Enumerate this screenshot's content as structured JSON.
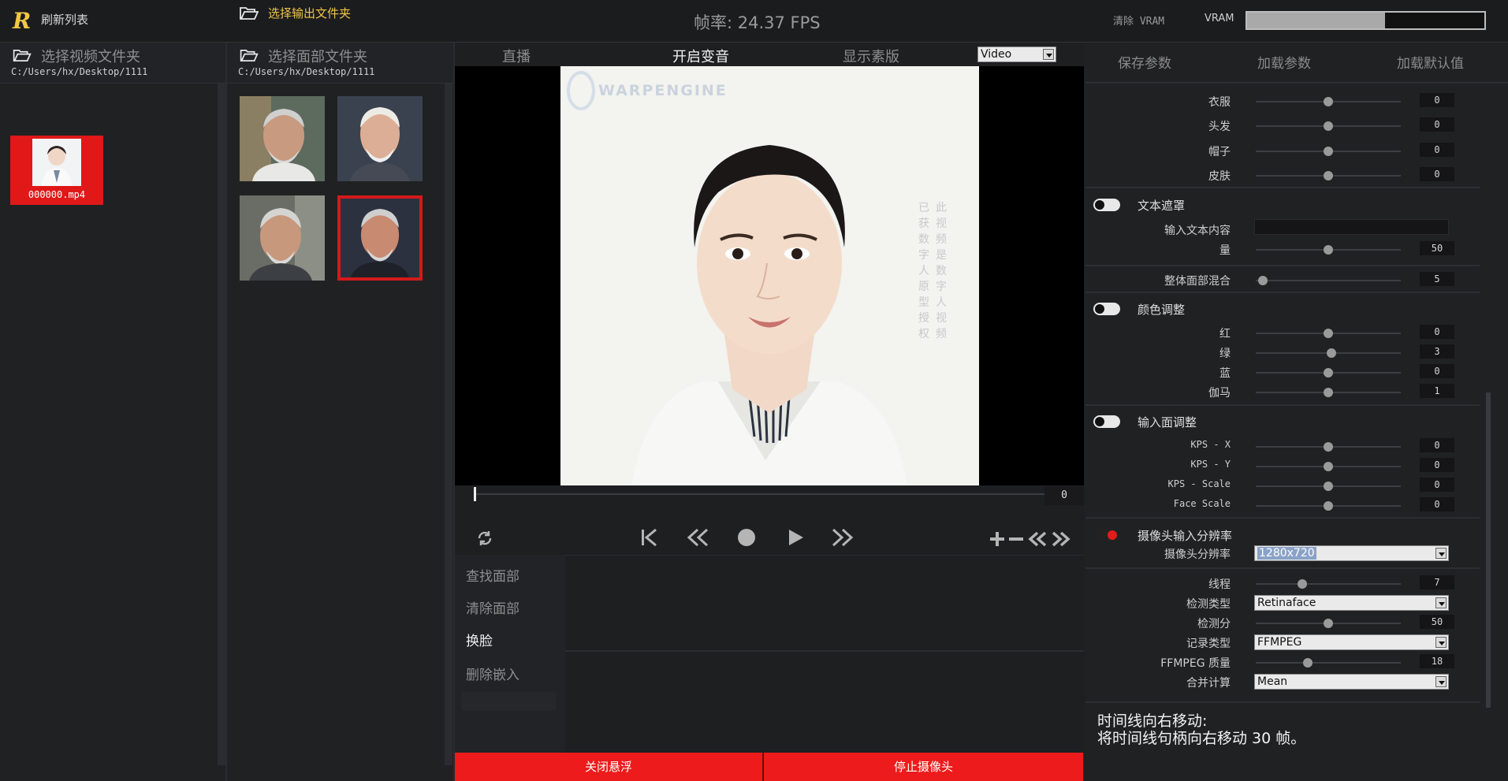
{
  "header": {
    "refresh_label": "刷新列表",
    "output_folder_label": "选择输出文件夹",
    "fps_text": "帧率: 24.37 FPS",
    "clear_vram_label": "清除 VRAM",
    "vram_label": "VRAM",
    "vram_usage_fraction": 0.58
  },
  "video_panel": {
    "title": "选择视频文件夹",
    "path": "C:/Users/hx/Desktop/1111",
    "items": [
      {
        "filename": "000000.mp4",
        "selected": true
      }
    ]
  },
  "face_panel": {
    "title": "选择面部文件夹",
    "path": "C:/Users/hx/Desktop/1111",
    "faces": [
      {
        "name": "face-thumbnail",
        "selected": false
      },
      {
        "name": "face-thumbnail",
        "selected": false
      },
      {
        "name": "face-thumbnail",
        "selected": false
      },
      {
        "name": "face-thumbnail",
        "selected": true
      }
    ]
  },
  "center": {
    "tabs": [
      "直播",
      "开启变音",
      "显示素版"
    ],
    "active_tab": 1,
    "mode_select": "Video",
    "watermark_logo": "WARPENGINE",
    "watermark_col1": "此视频是数字人视频",
    "watermark_col2": "已获数字人原型授权",
    "frame_value": "0",
    "actions": [
      "查找面部",
      "清除面部",
      "换脸",
      "删除嵌入"
    ],
    "active_action": 2,
    "bottom_buttons": [
      "关闭悬浮",
      "停止摄像头"
    ]
  },
  "right": {
    "header_buttons": [
      "保存参数",
      "加载参数",
      "加载默认值"
    ],
    "occlusion": [
      {
        "label": "衣服",
        "value": "0",
        "level": 0.5
      },
      {
        "label": "头发",
        "value": "0",
        "level": 0.5
      },
      {
        "label": "帽子",
        "value": "0",
        "level": 0.5
      },
      {
        "label": "皮肤",
        "value": "0",
        "level": 0.5
      }
    ],
    "text_mask": {
      "label": "文本遮罩",
      "on": false,
      "input_label": "输入文本内容",
      "amount_label": "量",
      "amount_value": "50",
      "amount_level": 0.5
    },
    "blend": {
      "label": "整体面部混合",
      "value": "5",
      "level": 0.05
    },
    "color": {
      "label": "颜色调整",
      "on": false,
      "rows": [
        {
          "label": "红",
          "value": "0",
          "level": 0.5
        },
        {
          "label": "绿",
          "value": "3",
          "level": 0.52
        },
        {
          "label": "蓝",
          "value": "0",
          "level": 0.5
        },
        {
          "label": "伽马",
          "value": "1",
          "level": 0.5
        }
      ]
    },
    "input_face": {
      "label": "输入面调整",
      "on": false,
      "rows": [
        {
          "label": "KPS - X",
          "value": "0",
          "level": 0.5
        },
        {
          "label": "KPS - Y",
          "value": "0",
          "level": 0.5
        },
        {
          "label": "KPS - Scale",
          "value": "0",
          "level": 0.5
        },
        {
          "label": "Face Scale",
          "value": "0",
          "level": 0.5
        }
      ]
    },
    "camera": {
      "label": "摄像头输入分辨率",
      "on": true,
      "res_label": "摄像头分辨率",
      "res_value": "1280x720"
    },
    "general": {
      "threads_label": "线程",
      "threads_value": "7",
      "threads_level": 0.32,
      "detect_type_label": "检测类型",
      "detect_type_value": "Retinaface",
      "detect_score_label": "检测分",
      "detect_score_value": "50",
      "detect_score_level": 0.5,
      "record_type_label": "记录类型",
      "record_type_value": "FFMPEG",
      "ffmpeg_quality_label": "FFMPEG 质量",
      "ffmpeg_quality_value": "18",
      "ffmpeg_quality_level": 0.36,
      "merge_label": "合并计算",
      "merge_value": "Mean"
    },
    "hint_line1": "时间线向右移动:",
    "hint_line2": "将时间线句柄向右移动 30 帧。"
  }
}
